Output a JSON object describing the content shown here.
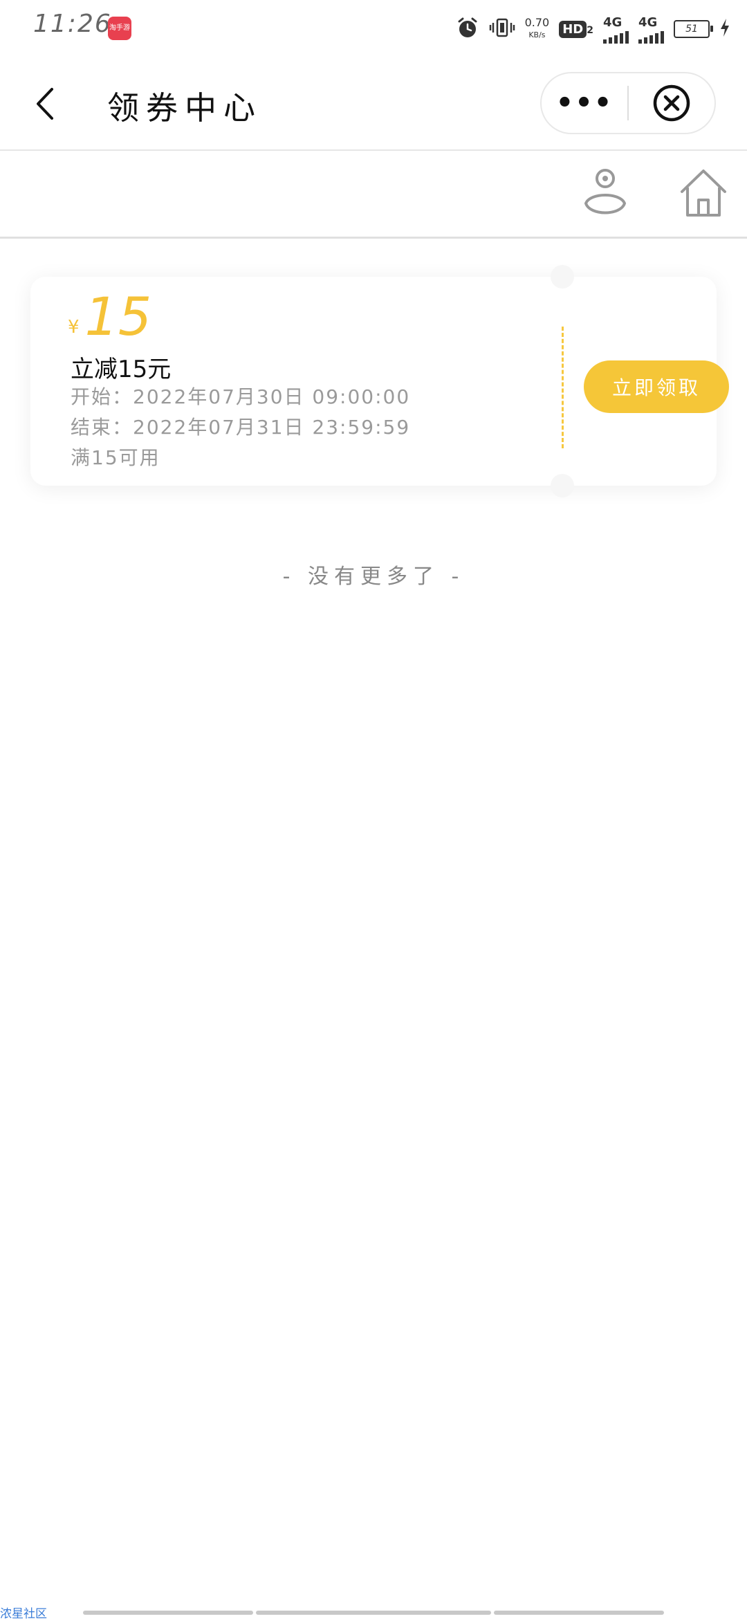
{
  "status_bar": {
    "time": "11:26",
    "app_icon_label": "淘手游",
    "net_speed_value": "0.70",
    "net_speed_unit": "KB/s",
    "hd_label": "HD",
    "hd_sub": "2",
    "network_1": "4G",
    "network_2": "4G",
    "battery": "51"
  },
  "header": {
    "title": "领券中心",
    "more_label": "•••",
    "icons": {
      "back": "chevron-left-icon",
      "close": "close-circle-icon",
      "user": "user-icon",
      "home": "home-icon"
    }
  },
  "coupon": {
    "currency": "¥",
    "amount": "15",
    "name": "立减15元",
    "start": "开始：2022年07月30日 09:00:00",
    "end": "结束：2022年07月31日 23:59:59",
    "condition": "满15可用",
    "claim_label": "立即领取",
    "accent_color": "#f5c638"
  },
  "footer": {
    "no_more": "- 没有更多了 -"
  },
  "watermark": "浓星社区"
}
